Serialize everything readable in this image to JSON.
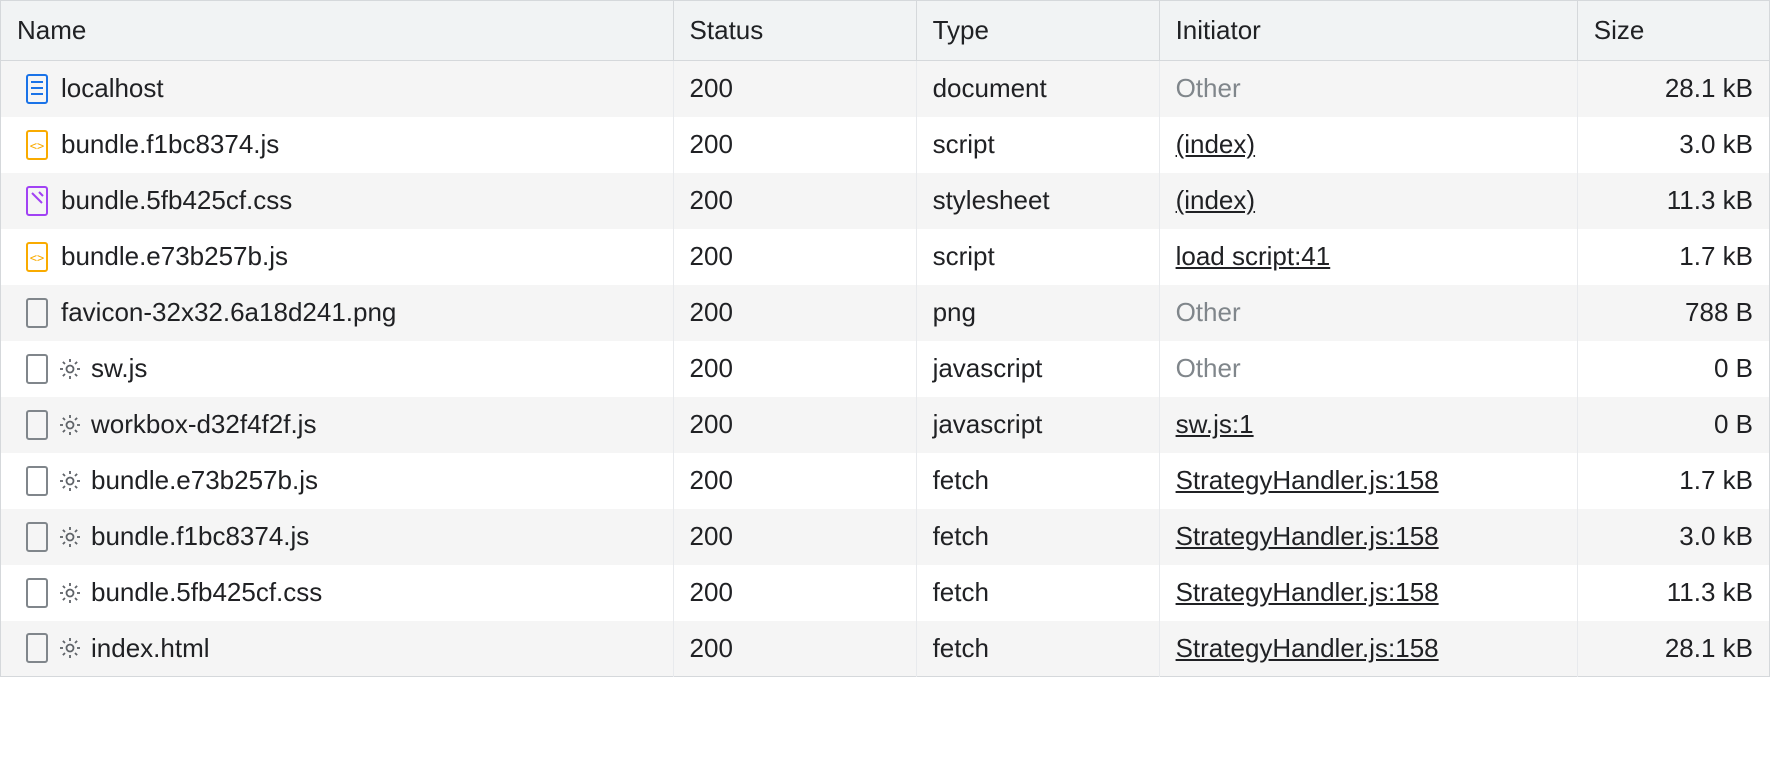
{
  "columns": {
    "name": "Name",
    "status": "Status",
    "type": "Type",
    "initiator": "Initiator",
    "size": "Size"
  },
  "rows": [
    {
      "icon": "document",
      "gear": false,
      "name": "localhost",
      "status": "200",
      "type": "document",
      "initiator": "Other",
      "initiator_link": false,
      "size": "28.1 kB"
    },
    {
      "icon": "js",
      "gear": false,
      "name": "bundle.f1bc8374.js",
      "status": "200",
      "type": "script",
      "initiator": "(index)",
      "initiator_link": true,
      "size": "3.0 kB"
    },
    {
      "icon": "css",
      "gear": false,
      "name": "bundle.5fb425cf.css",
      "status": "200",
      "type": "stylesheet",
      "initiator": "(index)",
      "initiator_link": true,
      "size": "11.3 kB"
    },
    {
      "icon": "js",
      "gear": false,
      "name": "bundle.e73b257b.js",
      "status": "200",
      "type": "script",
      "initiator": "load script:41",
      "initiator_link": true,
      "size": "1.7 kB"
    },
    {
      "icon": "blank",
      "gear": false,
      "name": "favicon-32x32.6a18d241.png",
      "status": "200",
      "type": "png",
      "initiator": "Other",
      "initiator_link": false,
      "size": "788 B"
    },
    {
      "icon": "blank",
      "gear": true,
      "name": "sw.js",
      "status": "200",
      "type": "javascript",
      "initiator": "Other",
      "initiator_link": false,
      "size": "0 B"
    },
    {
      "icon": "blank",
      "gear": true,
      "name": "workbox-d32f4f2f.js",
      "status": "200",
      "type": "javascript",
      "initiator": "sw.js:1",
      "initiator_link": true,
      "size": "0 B"
    },
    {
      "icon": "blank",
      "gear": true,
      "name": "bundle.e73b257b.js",
      "status": "200",
      "type": "fetch",
      "initiator": "StrategyHandler.js:158",
      "initiator_link": true,
      "size": "1.7 kB"
    },
    {
      "icon": "blank",
      "gear": true,
      "name": "bundle.f1bc8374.js",
      "status": "200",
      "type": "fetch",
      "initiator": "StrategyHandler.js:158",
      "initiator_link": true,
      "size": "3.0 kB"
    },
    {
      "icon": "blank",
      "gear": true,
      "name": "bundle.5fb425cf.css",
      "status": "200",
      "type": "fetch",
      "initiator": "StrategyHandler.js:158",
      "initiator_link": true,
      "size": "11.3 kB"
    },
    {
      "icon": "blank",
      "gear": true,
      "name": "index.html",
      "status": "200",
      "type": "fetch",
      "initiator": "StrategyHandler.js:158",
      "initiator_link": true,
      "size": "28.1 kB"
    }
  ]
}
